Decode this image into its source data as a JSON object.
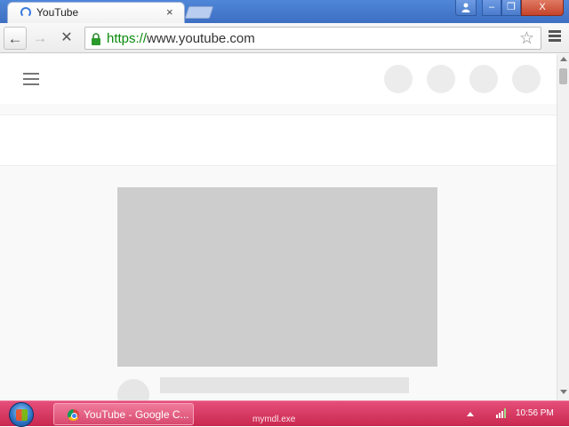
{
  "browser": {
    "tab": {
      "title": "YouTube",
      "close_glyph": "×",
      "loading": true
    },
    "window_controls": {
      "user_glyph": "👤",
      "minimize_glyph": "–",
      "maximize_glyph": "❐",
      "close_glyph": "X"
    },
    "toolbar": {
      "back_glyph": "←",
      "forward_glyph": "→",
      "stop_glyph": "✕",
      "url_scheme": "https://",
      "url_rest": "www.youtube.com",
      "star_glyph": "☆"
    }
  },
  "page": {
    "state": "loading-placeholders",
    "icons": [
      "hamburger-menu-icon",
      "placeholder-circle"
    ]
  },
  "taskbar": {
    "task_label": "YouTube - Google C...",
    "process_label": "mymdl.exe",
    "clock": "10:56 PM"
  },
  "colors": {
    "title_bar": "#4f86d8",
    "taskbar": "#d83a63",
    "secure_scheme": "#0a8a0a",
    "placeholder": "#cdcdcd"
  }
}
